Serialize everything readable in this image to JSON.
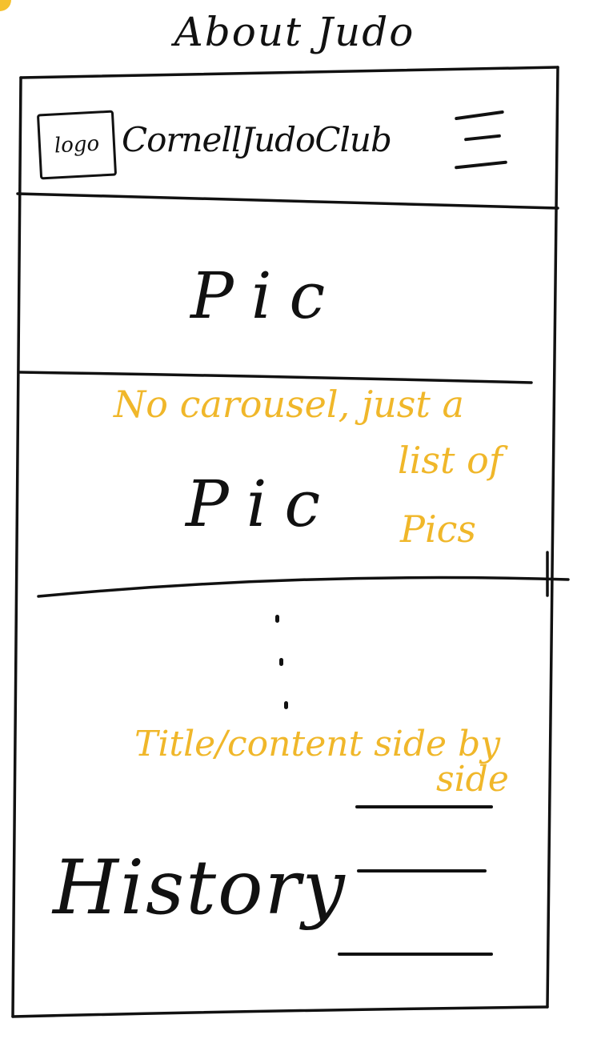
{
  "page_title": "About Judo",
  "header": {
    "logo_label": "logo",
    "site_title": "CornellJudoClub",
    "menu_icon": "hamburger-menu-icon"
  },
  "gallery": {
    "pic_labels": [
      "Pic",
      "Pic"
    ]
  },
  "annotations": {
    "carousel_note": [
      "No carousel, just a",
      "list of",
      "Pics"
    ],
    "layout_note": [
      "Title/content side by",
      "side"
    ]
  },
  "history": {
    "title": "History"
  },
  "colors": {
    "ink": "#111111",
    "annotation": "#f0b72a",
    "corner_dot": "#f5c12e"
  }
}
